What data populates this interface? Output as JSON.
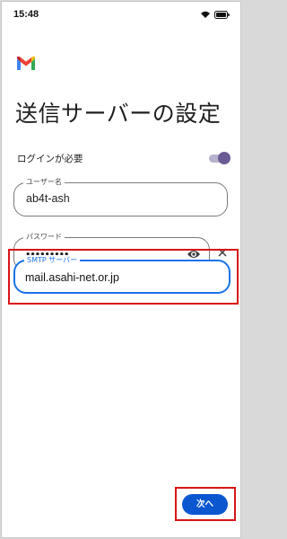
{
  "status_bar": {
    "time": "15:48",
    "icons": [
      "wifi-icon",
      "battery-icon"
    ]
  },
  "app": {
    "logo": "gmail-logo"
  },
  "page": {
    "title": "送信サーバーの設定"
  },
  "login_required": {
    "label": "ログインが必要",
    "enabled": true
  },
  "fields": {
    "username": {
      "label": "ユーザー名",
      "value": "ab4t-ash"
    },
    "password": {
      "label": "パスワード",
      "value": "•••••••••"
    },
    "smtp": {
      "label": "SMTP サーバー",
      "value": "mail.asahi-net.or.jp"
    }
  },
  "actions": {
    "next_label": "次へ"
  },
  "colors": {
    "accent": "#0b57d0",
    "focus": "#1a73e8",
    "highlight": "#d81418",
    "toggle": "#6b5b95"
  }
}
